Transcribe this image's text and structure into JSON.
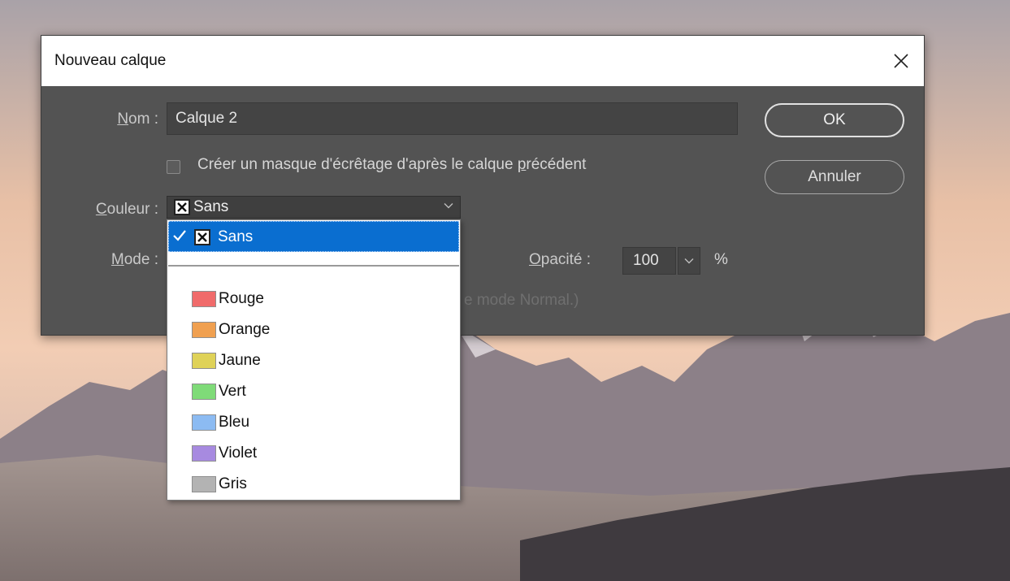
{
  "dialog": {
    "title": "Nouveau calque",
    "name_label": "Nom :",
    "name_label_first": "N",
    "name_label_rest": "om :",
    "name_value": "Calque 2",
    "clip_label_pre": "Créer un masque d'écrêtage d'après le calque ",
    "clip_label_u": "p",
    "clip_label_post": "récédent",
    "clip_checked": false,
    "color_label_first": "C",
    "color_label_rest": "ouleur :",
    "color_value": "Sans",
    "mode_label_first": "M",
    "mode_label_rest": "ode :",
    "opacity_label_first": "O",
    "opacity_label_rest": "pacité :",
    "opacity_value": "100",
    "opacity_unit": "%",
    "hint_partial": "e mode Normal.)",
    "ok_label": "OK",
    "cancel_label": "Annuler"
  },
  "color_dropdown": {
    "selected": "Sans",
    "options": [
      {
        "label": "Rouge",
        "color": "#f06b6b"
      },
      {
        "label": "Orange",
        "color": "#f0a050"
      },
      {
        "label": "Jaune",
        "color": "#dfd258"
      },
      {
        "label": "Vert",
        "color": "#7fdb78"
      },
      {
        "label": "Bleu",
        "color": "#8cbbf2"
      },
      {
        "label": "Violet",
        "color": "#a78ae0"
      },
      {
        "label": "Gris",
        "color": "#b3b3b3"
      }
    ]
  }
}
